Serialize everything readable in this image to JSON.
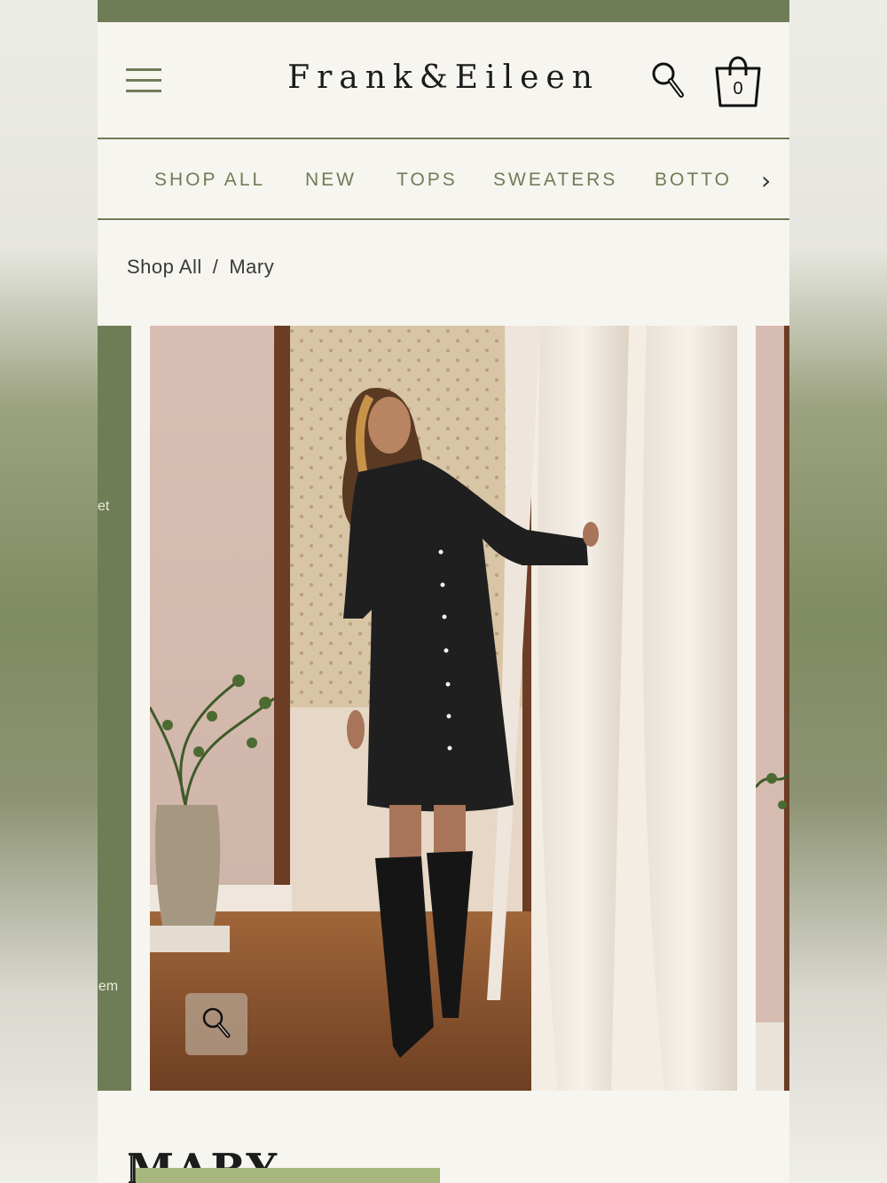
{
  "header": {
    "logo": "Frank&Eileen",
    "cart_count": "0"
  },
  "nav": {
    "items": [
      "SHOP ALL",
      "NEW",
      "TOPS",
      "SWEATERS",
      "BOTTO"
    ],
    "more": "›"
  },
  "breadcrumb": {
    "parent": "Shop All",
    "separator": "/",
    "current": "Mary"
  },
  "carousel": {
    "prev_slide_text_top": "ket",
    "prev_slide_text_bottom": "hem"
  },
  "product": {
    "title": "MARY"
  },
  "colors": {
    "brand_green": "#6f7d57",
    "page_bg": "#f7f5ef",
    "accent_overlay": "#a7b77e"
  }
}
